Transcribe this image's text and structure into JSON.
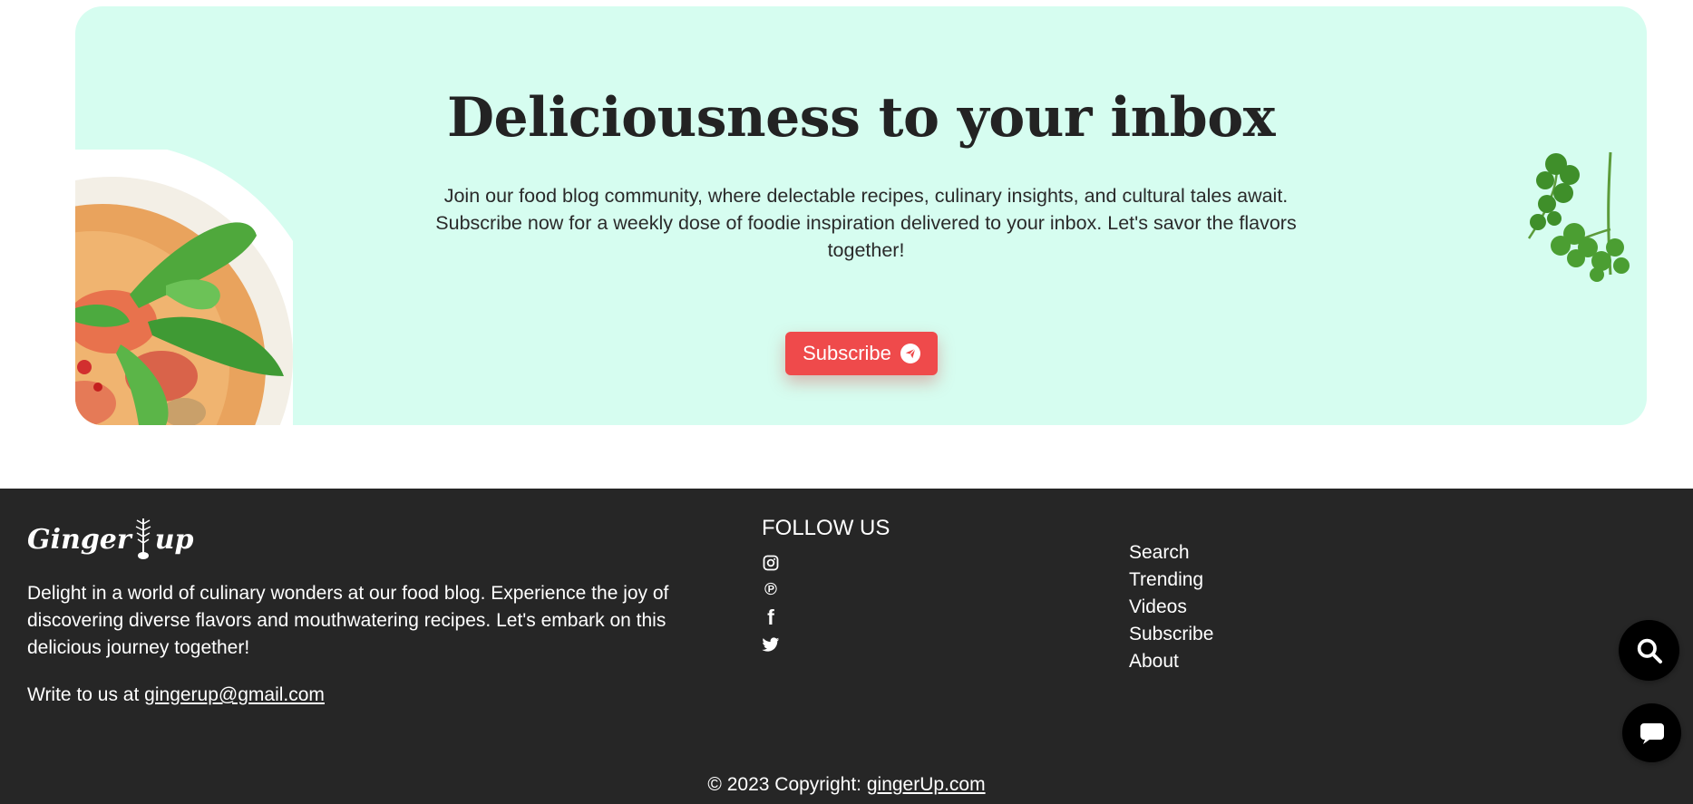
{
  "newsletter": {
    "heading": "Deliciousness to your inbox",
    "description": "Join our food blog community, where delectable recipes, culinary insights, and cultural tales await. Subscribe now for a weekly dose of foodie inspiration delivered to your inbox. Let's savor the flavors together!",
    "subscribe_label": "Subscribe"
  },
  "footer": {
    "brand_left": "Ginger",
    "brand_right": "up",
    "about": "Delight in a world of culinary wonders at our food blog. Experience the joy of discovering diverse flavors and mouthwatering recipes. Let's embark on this delicious journey together!",
    "write_prefix": "Write to us at",
    "email": "gingerup@gmail.com",
    "follow_title": "FOLLOW US",
    "social_icons": [
      "instagram-icon",
      "pinterest-icon",
      "facebook-icon",
      "twitter-icon"
    ],
    "links": [
      "Search",
      "Trending",
      "Videos",
      "Subscribe",
      "About"
    ],
    "copyright_prefix": "© 2023 Copyright:",
    "copyright_link": "gingerUp.com"
  },
  "colors": {
    "banner_bg": "#d6fdf0",
    "accent_red": "#ef4a4b",
    "footer_bg": "#262626",
    "heading_text": "#232323"
  }
}
